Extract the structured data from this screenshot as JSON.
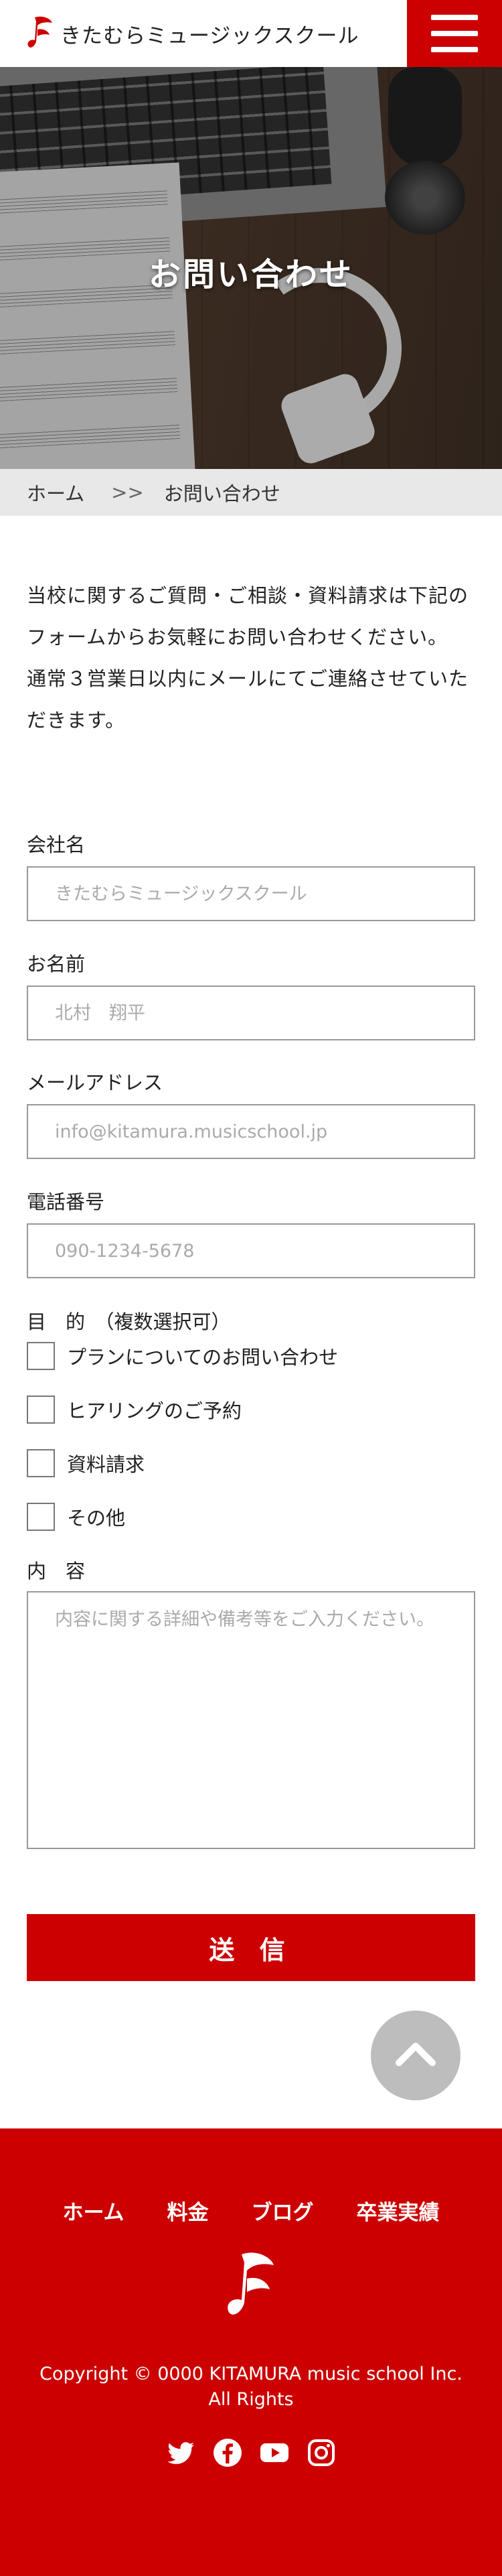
{
  "header": {
    "logo_text": "きたむらミュージックスクール",
    "brand_color": "#cc0000"
  },
  "hero": {
    "title": "お問い合わせ"
  },
  "breadcrumb": {
    "home": "ホーム",
    "separator": ">>",
    "current": "お問い合わせ"
  },
  "intro": {
    "paragraph1": "当校に関するご質問・ご相談・資料請求は下記のフォームからお気軽にお問い合わせください。",
    "paragraph2": "通常３営業日以内にメールにてご連絡させていただきます。"
  },
  "form": {
    "company": {
      "label": "会社名",
      "placeholder": "きたむらミュージックスクール"
    },
    "name": {
      "label": "お名前",
      "placeholder": "北村　翔平"
    },
    "email": {
      "label": "メールアドレス",
      "placeholder": "info@kitamura.musicschool.jp"
    },
    "phone": {
      "label": "電話番号",
      "placeholder": "090-1234-5678"
    },
    "purpose": {
      "label": "目　的　（複数選択可）",
      "options": [
        "プランについてのお問い合わせ",
        "ヒアリングのご予約",
        "資料請求",
        "その他"
      ]
    },
    "content": {
      "label": "内　容",
      "placeholder": "内容に関する詳細や備考等をご入力ください。"
    },
    "submit_label": "送 信"
  },
  "footer": {
    "nav": [
      "ホーム",
      "料金",
      "ブログ",
      "卒業実績"
    ],
    "copyright_line1": "Copyright © 0000 KITAMURA music school Inc.",
    "copyright_line2": "All Rights",
    "social_icons": [
      "twitter-icon",
      "facebook-icon",
      "youtube-icon",
      "instagram-icon"
    ]
  }
}
